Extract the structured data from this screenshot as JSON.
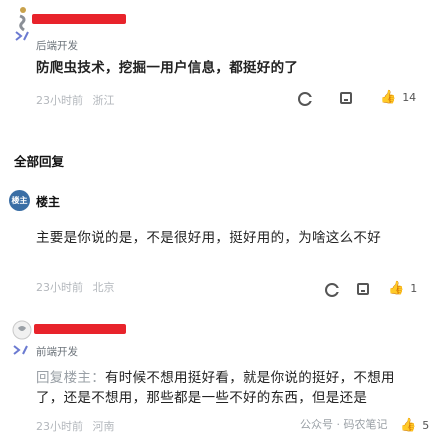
{
  "top_comment": {
    "author_role": "后端开发",
    "text": "防爬虫技术，挖掘一用户信息，都挺好的了",
    "time": "23小时前",
    "location": "浙江",
    "like_count": "14",
    "icons": [
      "avatar-logo-icon",
      "code-icon",
      "reply-icon",
      "bookmark-icon",
      "thumb-up-icon"
    ]
  },
  "section_title": "全部回复",
  "op_reply": {
    "avatar_label": "楼主",
    "name": "楼主",
    "text": "主要是你说的是，不是很好用，挺好用的，为啥这么不好",
    "time": "23小时前",
    "location": "北京",
    "like_count": "1"
  },
  "reply2": {
    "role": "前端开发",
    "quote_prefix": "回复楼主：",
    "text": "有时候不想用挺好看，就是你说的挺好，不想用了，还是不想用，那些都是一些不好的东西，但是还是",
    "time": "23小时前",
    "location": "河南",
    "watermark": "公众号 · 码农笔记",
    "like_count": "5"
  }
}
